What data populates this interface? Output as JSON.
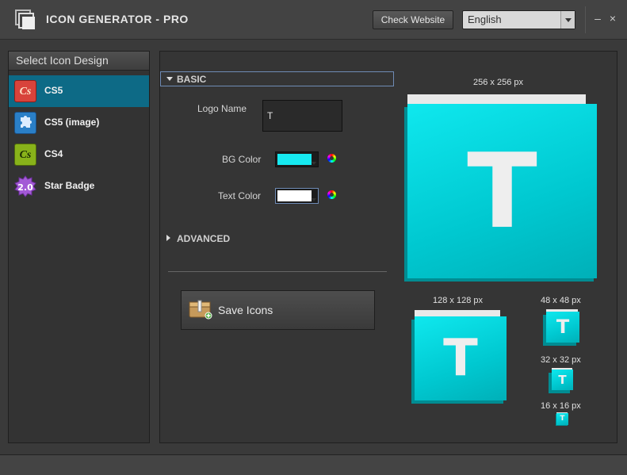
{
  "window": {
    "title": "ICON GENERATOR - PRO",
    "check_website_label": "Check Website",
    "language": "English",
    "minimize_glyph": "–",
    "close_glyph": "×"
  },
  "sidebar": {
    "header": "Select Icon Design",
    "items": [
      {
        "label": "CS5",
        "icon": "cs5-icon",
        "icon_text": "Cs",
        "selected": true
      },
      {
        "label": "CS5 (image)",
        "icon": "puzzle-icon",
        "selected": false
      },
      {
        "label": "CS4",
        "icon": "cs4-icon",
        "icon_text": "Cs",
        "selected": false
      },
      {
        "label": "Star Badge",
        "icon": "star-badge-icon",
        "icon_text": "2.0",
        "selected": false
      }
    ]
  },
  "form": {
    "basic_label": "BASIC",
    "advanced_label": "ADVANCED",
    "logo_name_label": "Logo Name",
    "logo_name_value": "T",
    "bg_color_label": "BG Color",
    "bg_color": "#16e9f0",
    "text_color_label": "Text Color",
    "text_color": "#ffffff",
    "save_label": "Save Icons"
  },
  "previews": {
    "letter": "T",
    "sizes": [
      "256 x 256 px",
      "128 x 128 px",
      "48 x 48 px",
      "32 x 32 px",
      "16 x 16 px"
    ]
  },
  "colors": {
    "accent_selected": "#0d6a86",
    "tile_cyan": "#00c8d0"
  }
}
